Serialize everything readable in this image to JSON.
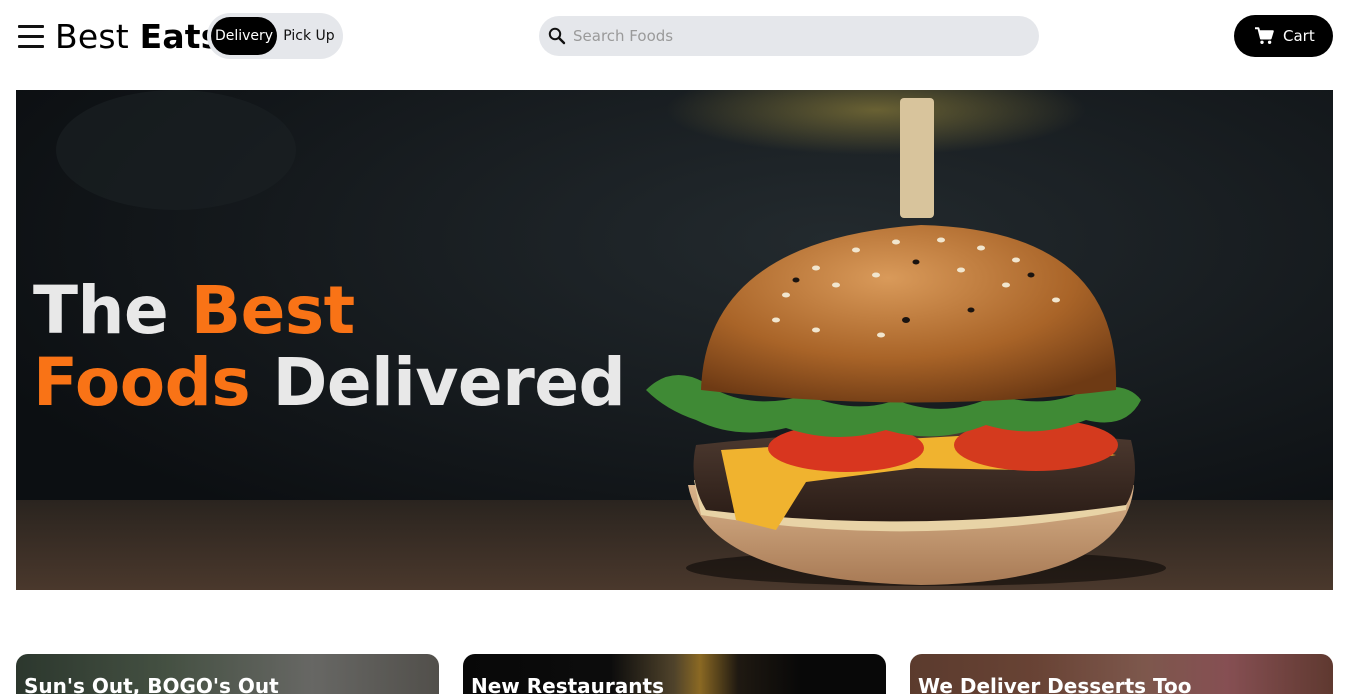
{
  "header": {
    "brand": {
      "first": "Best",
      "second": "Eats"
    },
    "toggle": {
      "active_label": "Delivery",
      "inactive_label": "Pick Up"
    },
    "search": {
      "placeholder": "Search Foods",
      "value": ""
    },
    "cart": {
      "label": "Cart"
    }
  },
  "hero": {
    "line1_white": "The",
    "line1_orange": "Best",
    "line2_orange": "Foods",
    "line2_white": "Delivered"
  },
  "cards": [
    {
      "title": "Sun's Out, BOGO's Out"
    },
    {
      "title": "New Restaurants"
    },
    {
      "title": "We Deliver Desserts Too"
    }
  ],
  "colors": {
    "accent": "#f97316",
    "toggle_bg": "#e5e7eb",
    "primary": "#000000"
  },
  "icons": {
    "menu": "hamburger-icon",
    "search": "search-icon",
    "cart": "cart-icon"
  }
}
